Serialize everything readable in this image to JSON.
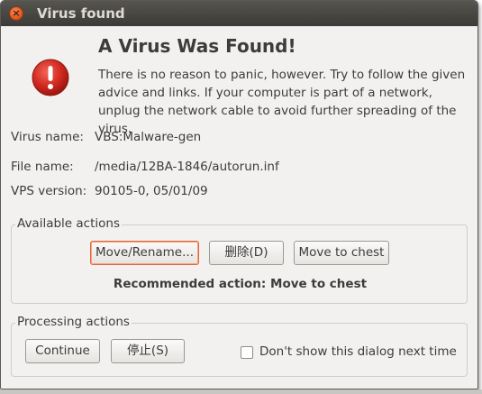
{
  "window": {
    "title": "Virus found",
    "close_glyph": "×"
  },
  "header": {
    "heading": "A Virus Was Found!",
    "message": "There is no reason to panic, however. Try to follow the given advice and links. If your computer is part of a network, unplug the network cable to avoid further spreading of the virus.",
    "icon": "warning-icon"
  },
  "details": {
    "virus_name_label": "Virus name:",
    "virus_name": "VBS:Malware-gen",
    "file_name_label": "File name:",
    "file_name": "/media/12BA-1846/autorun.inf",
    "vps_version_label": "VPS version:",
    "vps_version": "90105-0, 05/01/09"
  },
  "available_actions": {
    "label": "Available actions",
    "buttons": [
      "Move/Rename...",
      "删除(D)",
      "Move to chest"
    ],
    "recommended": "Recommended action: Move to chest"
  },
  "processing_actions": {
    "label": "Processing actions",
    "continue_label": "Continue",
    "stop_label": "停止(S)",
    "dont_show_label": "Don't show this dialog next time",
    "dont_show_checked": false
  },
  "colors": {
    "titlebar": "#3c3b37",
    "close_button": "#e25a1f",
    "warning_red": "#d22a1f",
    "focus_ring": "#e0683a"
  }
}
